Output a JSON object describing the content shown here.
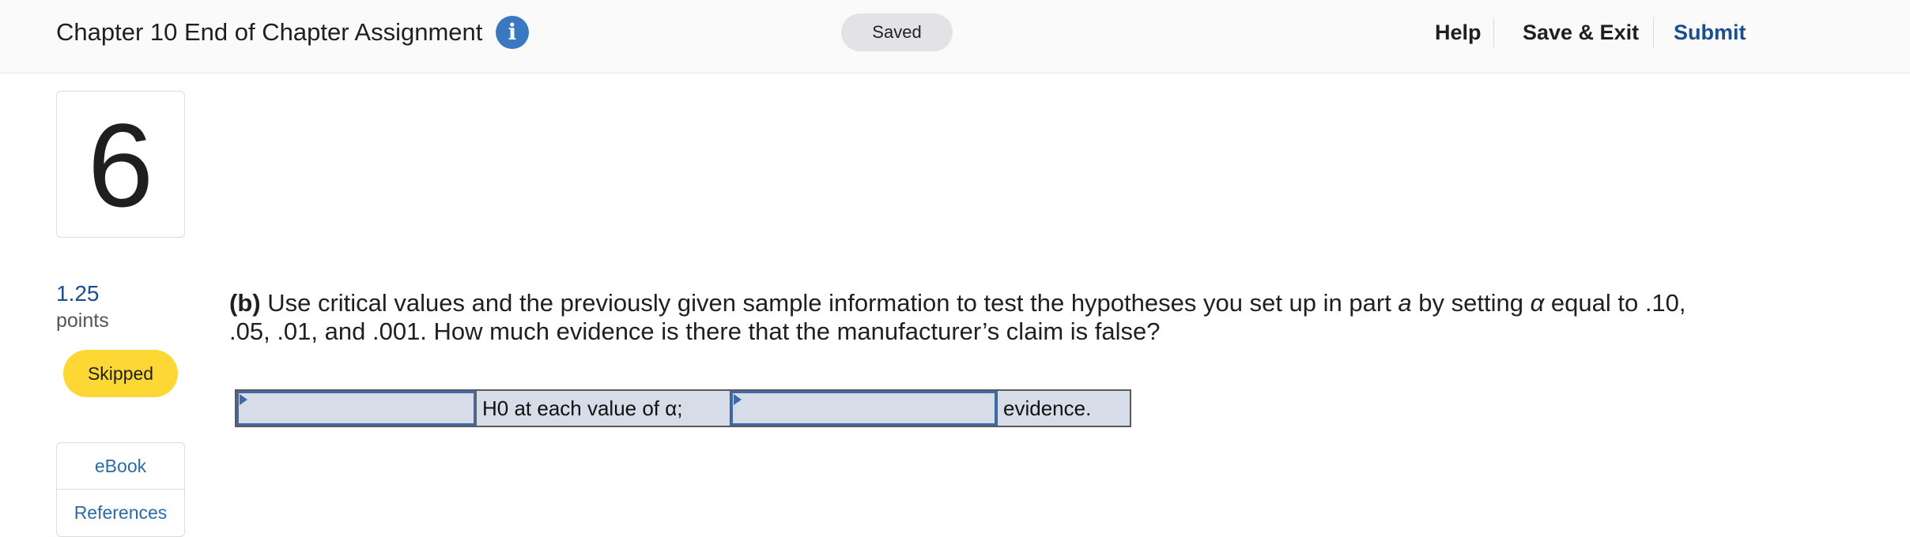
{
  "header": {
    "title": "Chapter 10 End of Chapter Assignment",
    "info_icon": "info-icon",
    "status": "Saved",
    "nav": {
      "help": "Help",
      "save_exit": "Save & Exit",
      "submit": "Submit"
    },
    "colors": {
      "accent": "#1a4e8c",
      "info": "#3a78c0"
    }
  },
  "question_panel": {
    "number": "6",
    "points_value": "1.25",
    "points_label": "points",
    "status_badge": "Skipped",
    "status_color": "#fdd835",
    "resources": [
      "eBook",
      "References"
    ]
  },
  "question": {
    "part_label": "(b)",
    "text_1": " Use critical values and the previously given sample information to test the hypotheses you set up in part ",
    "italic_a": "a",
    "text_2": " by setting ",
    "alpha": "α",
    "text_3": " equal to .10, .05, .01, and .001. How much evidence is there that the manufacturer’s claim is false?"
  },
  "answer": {
    "dropdown_1_value": "",
    "middle_text": "H0 at each value of α;",
    "dropdown_2_value": "",
    "end_text": "evidence."
  }
}
